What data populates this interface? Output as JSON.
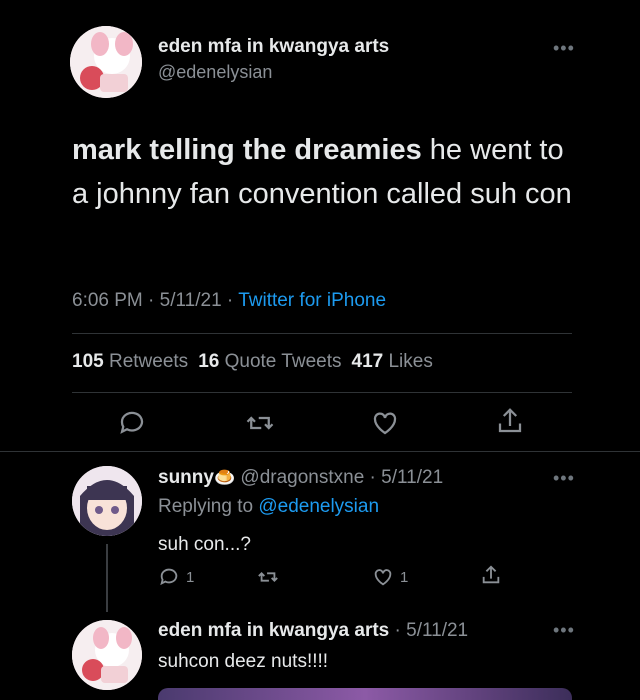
{
  "main_tweet": {
    "author_name": "eden mfa in kwangya arts",
    "author_handle": "@edenelysian",
    "text_bold": "mark telling the dreamies",
    "text_rest": " he went to a johnny fan convention called suh con",
    "time": "6:06 PM",
    "sep1": " · ",
    "date": "5/11/21",
    "sep2": " · ",
    "client": "Twitter for iPhone",
    "stats": {
      "retweets_count": "105",
      "retweets_label": "Retweets",
      "quotes_count": "16",
      "quotes_label": "Quote Tweets",
      "likes_count": "417",
      "likes_label": "Likes"
    }
  },
  "reply": {
    "author_name": "sunny",
    "author_emoji": "🍮",
    "author_handle": "@dragonstxne",
    "date": " · 5/11/21",
    "replying_label": "Replying to ",
    "replying_to": "@edenelysian",
    "text": "suh con...?",
    "reply_count": "1",
    "like_count": "1"
  },
  "nested_reply": {
    "author_name": "eden mfa in kwangya arts",
    "date": " · 5/11/21",
    "text": "suhcon deez nuts!!!!"
  },
  "icons": [
    "reply-icon",
    "retweet-icon",
    "like-icon",
    "share-icon",
    "more-icon"
  ],
  "colors": {
    "background": "#000000",
    "accent": "#1d9bf0",
    "muted": "#8b9096"
  }
}
